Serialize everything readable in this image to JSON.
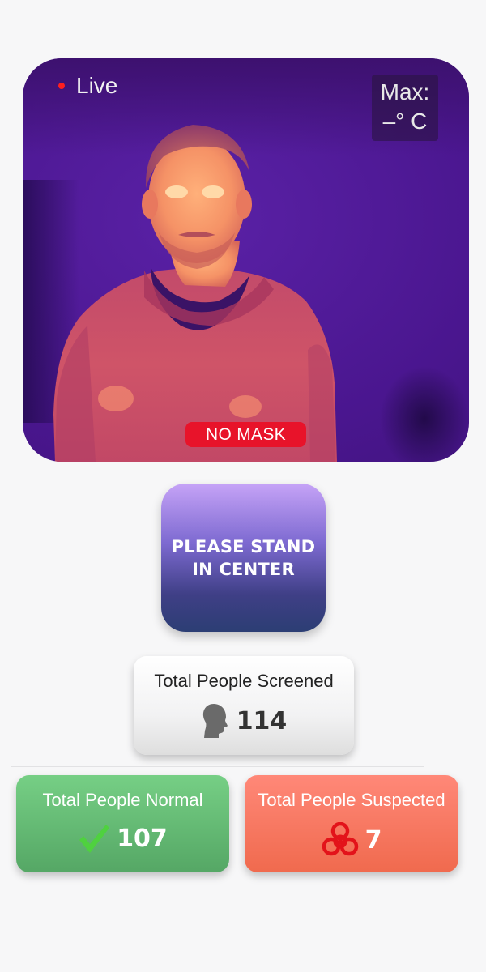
{
  "camera": {
    "live_label": "Live",
    "max_label": "Max:",
    "max_value": "–° C",
    "mask_status": "NO MASK"
  },
  "instruction": {
    "line1": "PLEASE STAND",
    "line2": "IN CENTER"
  },
  "stats": {
    "screened": {
      "label": "Total People Screened",
      "value": "114",
      "icon": "head-icon"
    },
    "normal": {
      "label": "Total People Normal",
      "value": "107",
      "icon": "check-icon"
    },
    "suspected": {
      "label": "Total People Suspected",
      "value": "7",
      "icon": "biohazard-icon"
    }
  },
  "colors": {
    "live_dot": "#ff1f1f",
    "mask_tag": "#e8132a",
    "normal": "#5fb86f",
    "suspected": "#f57a62",
    "check": "#4fd13f",
    "biohazard": "#e3131a"
  }
}
